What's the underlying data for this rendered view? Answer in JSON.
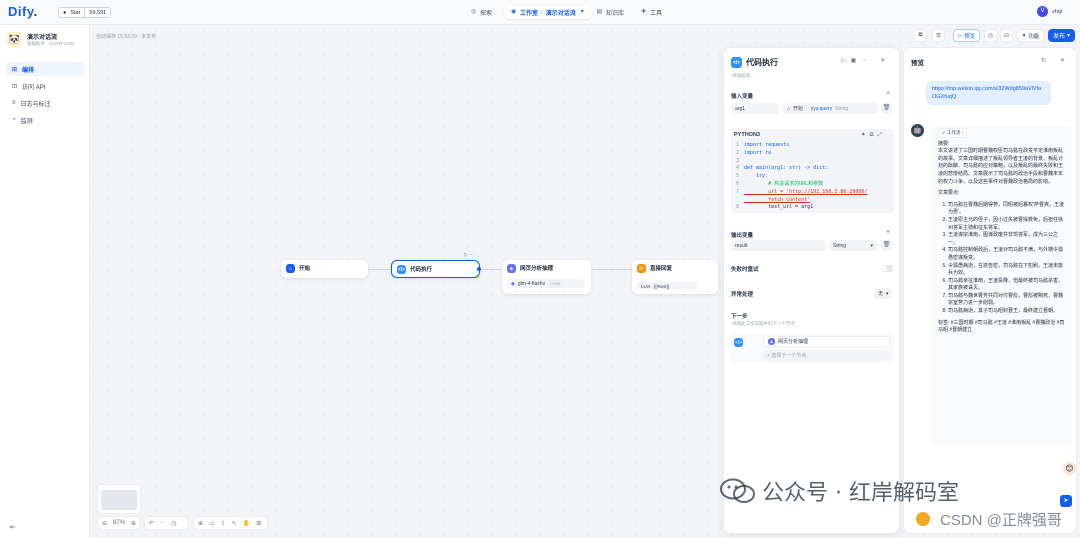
{
  "topbar": {
    "logo": "Dify",
    "star_label": "Star",
    "star_count": "59,591",
    "nav_explore": "探索",
    "nav_studio": "工作室",
    "nav_app": "演示对话流",
    "nav_knowledge": "知识库",
    "nav_tools": "工具",
    "user_initial": "V",
    "user_name": "vhqi"
  },
  "sidebar": {
    "app_name": "演示对话流",
    "app_type": "基础助手 · CHATFLOW",
    "items": [
      {
        "label": "编排",
        "icon": "⊞"
      },
      {
        "label": "访问 API",
        "icon": "⊡"
      },
      {
        "label": "日志与标注",
        "icon": "≡"
      },
      {
        "label": "监测",
        "icon": "◔"
      }
    ]
  },
  "header": {
    "autosave": "自动保存 15:53:29 · 未发布",
    "preview_label": "预览",
    "features_label": "功能",
    "publish_label": "发布"
  },
  "nodes": {
    "start": "开始",
    "code": "代码执行",
    "parse": "网页分析抽理",
    "model": "glm-4-flashx",
    "model_badge": "CHAT",
    "answer": "直接回复",
    "answer_sub": "LLM · {{#text}}"
  },
  "zoom": {
    "level": "87%"
  },
  "panel": {
    "title": "代码执行",
    "description": "添加描述...",
    "input_vars_label": "输入变量",
    "input_var_name": "arg1",
    "input_var_source": "开始",
    "input_var_ref": "sys.query",
    "input_var_type": "String",
    "code_lang": "PYTHON3",
    "code": [
      {
        "n": "1",
        "t": "import requests"
      },
      {
        "n": "2",
        "t": "import re"
      },
      {
        "n": "3",
        "t": ""
      },
      {
        "n": "4",
        "t": "def main(arg1: str) -> dict:"
      },
      {
        "n": "5",
        "t": "    try:"
      },
      {
        "n": "6",
        "t": "        # 构造请求的URL和参数"
      },
      {
        "n": "7",
        "t": "        url = 'http://192.168.3.86:20000/"
      },
      {
        "n": "",
        "t": "        fetch_content'"
      },
      {
        "n": "8",
        "t": "        test_url = arg1"
      }
    ],
    "output_vars_label": "输出变量",
    "output_var_name": "result",
    "output_var_type": "String",
    "retry_label": "失败时重试",
    "error_label": "异常处理",
    "error_value": "无",
    "next_label": "下一步",
    "next_desc": "添加此工作流程中的下一个节点",
    "next_node": "网页分析抽理",
    "add_next": "+ 选择下一个节点"
  },
  "preview": {
    "title": "预览",
    "user_msg": "https://mp.weixin.qq.com/s/32Wdg859aVlVfaOGXfuqQ",
    "workflow_tag": "工作流",
    "summary_title": "摘要:",
    "summary": "本文讲述了三国时期曹魏权臣司马懿在政变平定淮南叛乱的故事。文章详细描述了叛乱领导者王凌的背景、叛乱计划的酝酿、司马懿的应对策略，以及叛乱的最终失败和王凌的悲惨结局。文章展示了司马懿的政治手段和曹魏末年的权力斗争，以及这些事件对曹魏政治格局的影响。",
    "points_title": "文章要点:",
    "points": [
      "司马懿在曹魏后期得势，同昭被后篡权'萨曹爽，王凌为惠'。",
      "王凌原主允的侄子，因小过失被曹操救免，后担任徐州将军主骑和征东将军。",
      "王凌谋宗淮南，图谋政废并非驾将军，成为三公之一。",
      "司马懿控制朝政后，王凌对司马懿不满，与外甥令狐愚密谋叛变。",
      "令狐愚病逝，在遂告密，司马懿在下犯刷，王凌未能兵为效。",
      "司马懿亲征淮南，王凌投降，但最终被司马懿杀害，其家族被诛灭。",
      "司马懿与魏世曹芳共同对付曹彪，曹彪被赐死，曹魏宗室势力进一步削弱。",
      "司马懿病逝，其子司马昭封晋王，最终建立晋朝。"
    ],
    "tags": "标签: #三国时期 #司马懿 #王凌 #淮南叛乱 #曹魏政治 #司马昭 #晋朝建立"
  },
  "watermark": {
    "line1": "公众号 · 红岸解码室",
    "line2": "CSDN @正牌强哥"
  },
  "colors": {
    "accent": "#155eef",
    "code_node": "#2e90fa",
    "start_node": "#155eef",
    "parse_node": "#6172f3",
    "answer_node": "#f79009"
  }
}
